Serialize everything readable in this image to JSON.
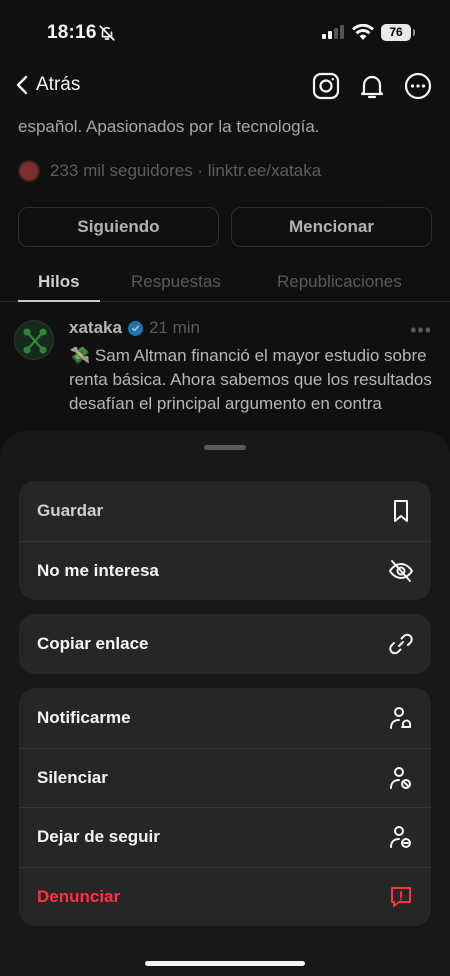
{
  "status_bar": {
    "time": "18:16",
    "battery": "76"
  },
  "nav": {
    "back_label": "Atrás",
    "icons": [
      "instagram-icon",
      "bell-icon",
      "more-icon"
    ]
  },
  "profile": {
    "bio": "español. Apasionados por la tecnología.",
    "followers": "233 mil seguidores · linktr.ee/xataka",
    "following_button": "Siguiendo",
    "mention_button": "Mencionar"
  },
  "tabs": [
    {
      "label": "Hilos",
      "active": true
    },
    {
      "label": "Respuestas",
      "active": false
    },
    {
      "label": "Republicaciones",
      "active": false
    }
  ],
  "post": {
    "author": "xataka",
    "time_ago": "21 min",
    "emoji": "💸",
    "text": "Sam Altman financió el mayor estudio sobre renta básica. Ahora sabemos que los resultados desafían el principal argumento en contra"
  },
  "sheet": {
    "groups": [
      [
        {
          "label": "Guardar",
          "icon": "bookmark-icon"
        },
        {
          "label": "No me interesa",
          "icon": "eye-off-icon"
        }
      ],
      [
        {
          "label": "Copiar enlace",
          "icon": "link-icon"
        }
      ],
      [
        {
          "label": "Notificarme",
          "icon": "user-bell-icon"
        },
        {
          "label": "Silenciar",
          "icon": "user-mute-icon"
        },
        {
          "label": "Dejar de seguir",
          "icon": "user-unfollow-icon"
        },
        {
          "label": "Denunciar",
          "icon": "report-icon",
          "color": "#ff3040"
        }
      ]
    ]
  }
}
